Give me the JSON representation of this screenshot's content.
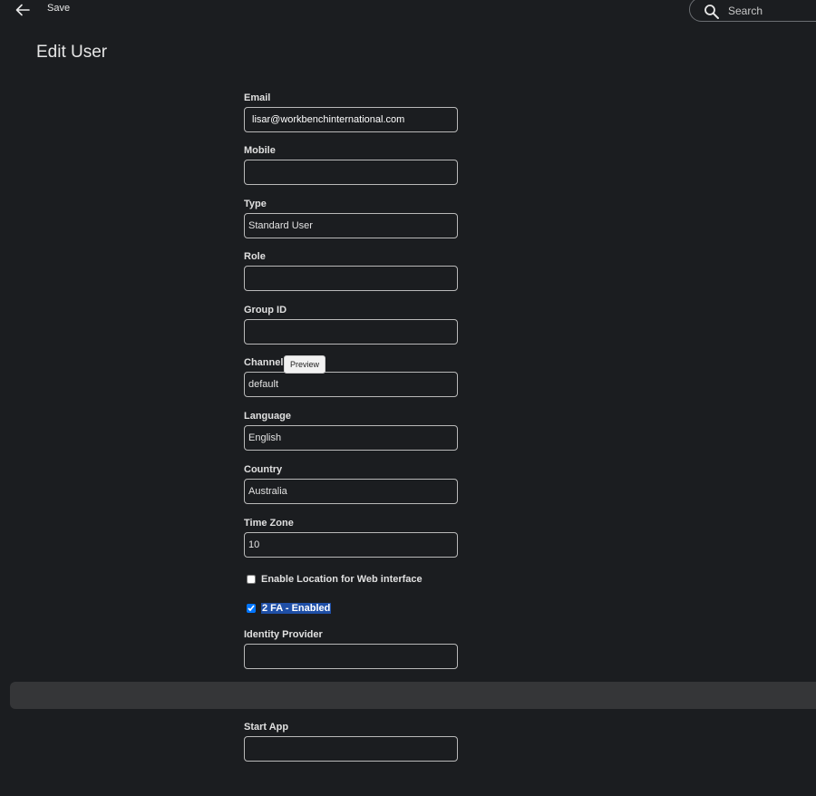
{
  "toolbar": {
    "back_icon": "arrow-left-icon",
    "save_label": "Save",
    "search_placeholder": "Search",
    "search_icon": "search-icon"
  },
  "page": {
    "title": "Edit User"
  },
  "form": {
    "email": {
      "label": "Email",
      "value": "lisar@workbenchinternational.com"
    },
    "mobile": {
      "label": "Mobile",
      "value": ""
    },
    "type": {
      "label": "Type",
      "value": "Standard User"
    },
    "role": {
      "label": "Role",
      "value": ""
    },
    "group_id": {
      "label": "Group ID",
      "value": ""
    },
    "channel": {
      "label": "Channel",
      "value": "default",
      "tooltip": "Preview"
    },
    "language": {
      "label": "Language",
      "value": "English"
    },
    "country": {
      "label": "Country",
      "value": "Australia"
    },
    "time_zone": {
      "label": "Time Zone",
      "value": "10"
    },
    "enable_location": {
      "label": "Enable Location for Web interface",
      "checked": false
    },
    "two_fa": {
      "label": "2 FA - Enabled",
      "checked": true
    },
    "identity_provider": {
      "label": "Identity Provider",
      "value": ""
    },
    "start_app": {
      "label": "Start App",
      "value": ""
    }
  },
  "colors": {
    "background": "#1b1d20",
    "input_border": "#b9b9b9",
    "selection": "#1f4fa6",
    "band": "#353638"
  }
}
